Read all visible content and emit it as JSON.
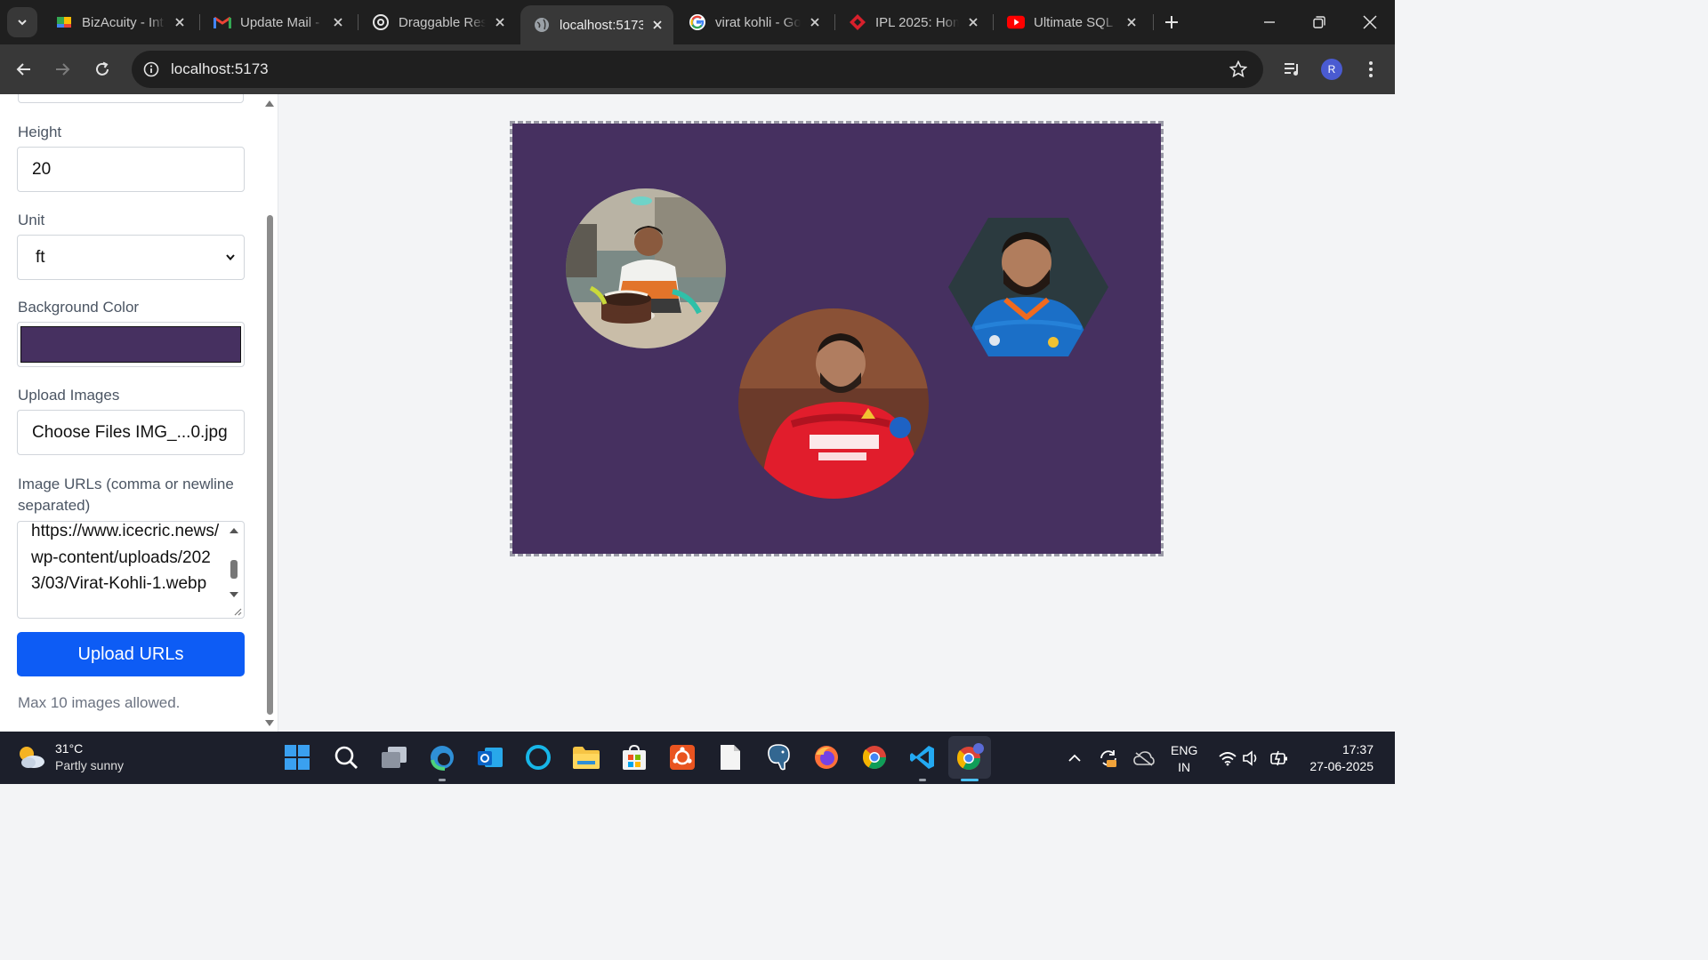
{
  "browser": {
    "tabs": [
      {
        "title": "BizAcuity - Int",
        "icon": "bizacuity-icon",
        "active": false
      },
      {
        "title": "Update Mail -",
        "icon": "gmail-icon",
        "active": false
      },
      {
        "title": "Draggable Res",
        "icon": "openai-icon",
        "active": false
      },
      {
        "title": "localhost:5173",
        "icon": "globe-icon",
        "active": true
      },
      {
        "title": "virat kohli - Go",
        "icon": "google-icon",
        "active": false
      },
      {
        "title": "IPL 2025: Hom",
        "icon": "ipl-icon",
        "active": false
      },
      {
        "title": "Ultimate SQL",
        "icon": "youtube-icon",
        "active": false
      }
    ],
    "url": "localhost:5173",
    "profile_initial": "R"
  },
  "sidebar": {
    "height_label": "Height",
    "height_value": "20",
    "unit_label": "Unit",
    "unit_value": "ft",
    "bg_label": "Background Color",
    "bg_color": "#463060",
    "upload_images_label": "Upload Images",
    "file_input_text": "Choose Files IMG_...0.jpg",
    "urls_label": "Image URLs (comma or newline separated)",
    "urls_value": "https://www.icecric.news/wp-content/uploads/2023/03/Virat-Kohli-1.webp",
    "upload_button": "Upload URLs",
    "note": "Max 10 images allowed."
  },
  "canvas": {
    "background": "#463060",
    "images": [
      {
        "shape": "circle",
        "name": "uploaded-photo-birthday"
      },
      {
        "shape": "circle",
        "name": "uploaded-photo-kohli-rcb"
      },
      {
        "shape": "hexagon",
        "name": "uploaded-photo-kohli-india"
      }
    ]
  },
  "taskbar": {
    "weather_temp": "31°C",
    "weather_cond": "Partly sunny",
    "lang_1": "ENG",
    "lang_2": "IN",
    "time": "17:37",
    "date": "27-06-2025"
  }
}
